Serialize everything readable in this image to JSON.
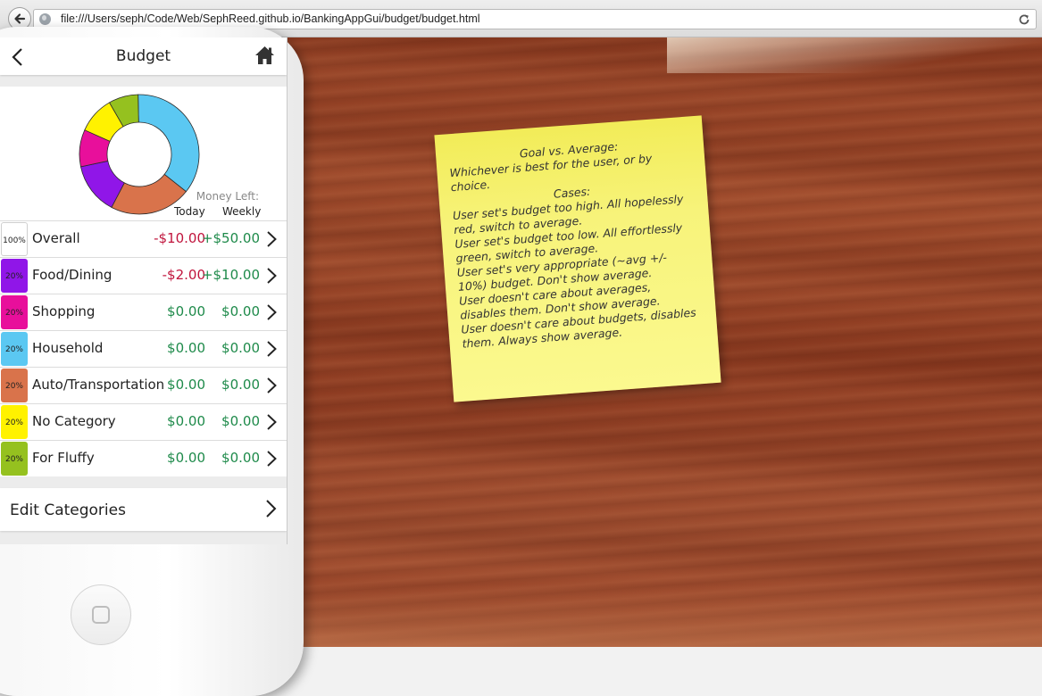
{
  "browser": {
    "url": "file:///Users/seph/Code/Web/SephReed.github.io/BankingAppGui/budget/budget.html",
    "icons": [
      "back-icon",
      "globe-icon",
      "reload-icon"
    ]
  },
  "app": {
    "title": "Budget",
    "icons": [
      "chevron-left-icon",
      "home-icon",
      "chevron-right-icon"
    ],
    "money_left_label": "Money Left:",
    "col_today": "Today",
    "col_weekly": "Weekly",
    "donut_segments": [
      {
        "name": "Household",
        "color": "#5bc8f2",
        "fraction": 0.36
      },
      {
        "name": "Auto/Transportation",
        "color": "#d9734b",
        "fraction": 0.22
      },
      {
        "name": "Food/Dining",
        "color": "#9016e8",
        "fraction": 0.14
      },
      {
        "name": "Shopping",
        "color": "#e80f9b",
        "fraction": 0.1
      },
      {
        "name": "No Category",
        "color": "#fff200",
        "fraction": 0.1
      },
      {
        "name": "For Fluffy",
        "color": "#95c11f",
        "fraction": 0.08
      }
    ],
    "categories": [
      {
        "pct": "100%",
        "name": "Overall",
        "today": "-$10.00",
        "weekly": "+$50.00",
        "today_class": "neg",
        "weekly_class": "pos",
        "color": "#ffffff"
      },
      {
        "pct": "20%",
        "name": "Food/Dining",
        "today": "-$2.00",
        "weekly": "+$10.00",
        "today_class": "neg",
        "weekly_class": "pos",
        "color": "#9016e8"
      },
      {
        "pct": "20%",
        "name": "Shopping",
        "today": "$0.00",
        "weekly": "$0.00",
        "today_class": "pos",
        "weekly_class": "pos",
        "color": "#e80f9b"
      },
      {
        "pct": "20%",
        "name": "Household",
        "today": "$0.00",
        "weekly": "$0.00",
        "today_class": "pos",
        "weekly_class": "pos",
        "color": "#5bc8f2"
      },
      {
        "pct": "20%",
        "name": "Auto/Transportation",
        "today": "$0.00",
        "weekly": "$0.00",
        "today_class": "pos",
        "weekly_class": "pos",
        "color": "#d9734b"
      },
      {
        "pct": "20%",
        "name": "No Category",
        "today": "$0.00",
        "weekly": "$0.00",
        "today_class": "pos",
        "weekly_class": "pos",
        "color": "#fff200"
      },
      {
        "pct": "20%",
        "name": "For Fluffy",
        "today": "$0.00",
        "weekly": "$0.00",
        "today_class": "pos",
        "weekly_class": "pos",
        "color": "#95c11f"
      }
    ],
    "edit_categories": "Edit Categories"
  },
  "sticky_note": {
    "heading1": "Goal vs. Average:",
    "line1": "Whichever is best for the user, or by choice.",
    "heading2": "Cases:",
    "cases": [
      "User set's budget too high. All hopelessly red, switch to average.",
      "User set's budget too low. All effortlessly green, switch to average.",
      "User set's very appropriate (~avg +/- 10%) budget. Don't show average.",
      "User doesn't care about averages, disables them. Don't show average.",
      "User doesn't care about budgets, disables them. Always show average."
    ]
  }
}
